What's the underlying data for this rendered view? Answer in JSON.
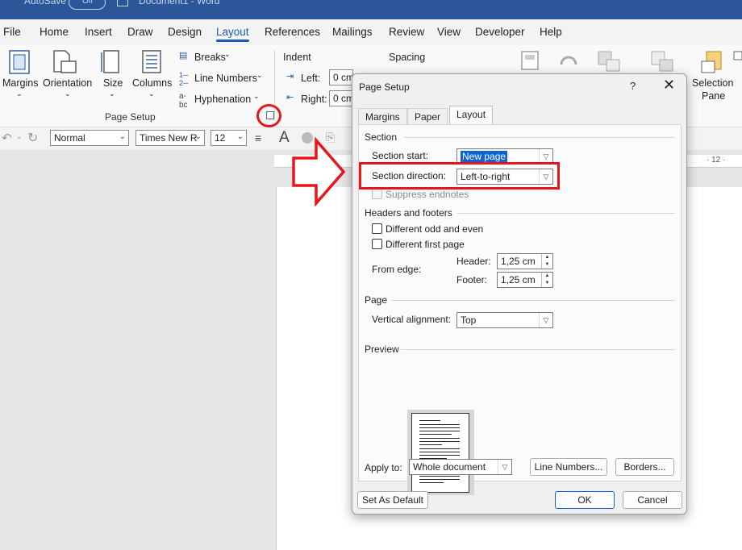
{
  "titlebar": {
    "autosave": "AutoSave",
    "toggle": "Off",
    "doc": "Document1  -  Word"
  },
  "menu_tabs": [
    "File",
    "Home",
    "Insert",
    "Draw",
    "Design",
    "Layout",
    "References",
    "Mailings",
    "Review",
    "View",
    "Developer",
    "Help"
  ],
  "active_tab": "Layout",
  "ribbon": {
    "margins": "Margins",
    "orientation": "Orientation",
    "size": "Size",
    "columns": "Columns",
    "breaks": "Breaks",
    "line_numbers": "Line Numbers",
    "hyphenation": "Hyphenation",
    "group_label": "Page Setup",
    "indent_label": "Indent",
    "spacing_label": "Spacing",
    "indent_left": "Left:",
    "indent_right": "Right:",
    "indent_left_val": "0 cm",
    "indent_right_val": "0 cm",
    "selection_pane_1": "Selection",
    "selection_pane_2": "Pane"
  },
  "toolbar2": {
    "style": "Normal",
    "font": "Times New R",
    "size": "12"
  },
  "ruler": {
    "mark": "· 12 ·"
  },
  "dialog": {
    "title": "Page Setup",
    "help": "?",
    "close": "✕",
    "tabs": [
      "Margins",
      "Paper",
      "Layout"
    ],
    "active_tab": "Layout",
    "section": {
      "title": "Section",
      "start_label": "Section start:",
      "start_value": "New page",
      "direction_label": "Section direction:",
      "direction_value": "Left-to-right",
      "suppress_endnotes": "Suppress endnotes"
    },
    "headers_footers": {
      "title": "Headers and footers",
      "diff_odd_even": "Different odd and even",
      "diff_first_page": "Different first page",
      "from_edge": "From edge:",
      "header_label": "Header:",
      "header_value": "1,25 cm",
      "footer_label": "Footer:",
      "footer_value": "1,25 cm"
    },
    "page": {
      "title": "Page",
      "valign_label": "Vertical alignment:",
      "valign_value": "Top"
    },
    "preview": {
      "title": "Preview"
    },
    "apply_to_label": "Apply to:",
    "apply_to_value": "Whole document",
    "line_numbers_button": "Line Numbers...",
    "borders_button": "Borders...",
    "set_default_button": "Set As Default",
    "ok_button": "OK",
    "cancel_button": "Cancel"
  },
  "colors": {
    "accent": "#185abd",
    "titlebar": "#2b579a",
    "highlight": "#e8161b",
    "selection": "#0a64d6"
  }
}
